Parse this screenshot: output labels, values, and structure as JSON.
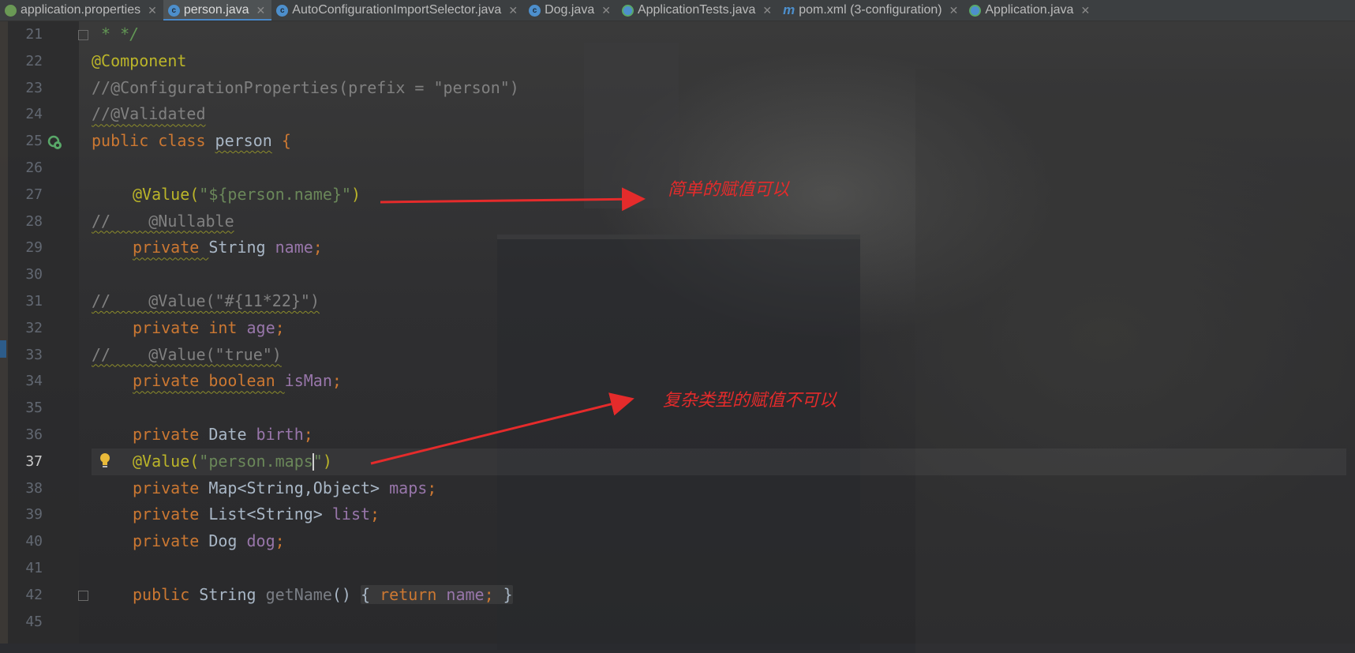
{
  "tabs": [
    {
      "label": "application.properties",
      "icon": "properties-file-icon",
      "kind": "props",
      "active": false
    },
    {
      "label": "person.java",
      "icon": "java-class-icon",
      "kind": "c",
      "active": true
    },
    {
      "label": "AutoConfigurationImportSelector.java",
      "icon": "java-class-icon",
      "kind": "c",
      "active": false
    },
    {
      "label": "Dog.java",
      "icon": "java-class-icon",
      "kind": "c",
      "active": false
    },
    {
      "label": "ApplicationTests.java",
      "icon": "java-test-class-icon",
      "kind": "test",
      "active": false
    },
    {
      "label": "pom.xml (3-configuration)",
      "icon": "maven-icon",
      "kind": "m",
      "active": false
    },
    {
      "label": "Application.java",
      "icon": "spring-boot-app-icon",
      "kind": "test",
      "active": false
    }
  ],
  "line_numbers": [
    "21",
    "22",
    "23",
    "24",
    "25",
    "26",
    "27",
    "28",
    "29",
    "30",
    "31",
    "32",
    "33",
    "34",
    "35",
    "36",
    "37",
    "38",
    "39",
    "40",
    "41",
    "42",
    "45"
  ],
  "current_line": "37",
  "code": {
    "l21": " * */",
    "l22": "@Component",
    "l23": "//@ConfigurationProperties(prefix = \"person\")",
    "l24": "//@Validated",
    "l25_kw": "public class ",
    "l25_name": "person",
    "l25_brace": " {",
    "l27_ann": "@Value(",
    "l27_str": "\"${person.name}\"",
    "l27_end": ")",
    "l28": "//    @Nullable",
    "l29_kw": "private ",
    "l29_type": "String ",
    "l29_field": "name",
    "l29_end": ";",
    "l31": "//    @Value(\"#{11*22}\")",
    "l32_kw": "private int ",
    "l32_field": "age",
    "l32_end": ";",
    "l33": "//    @Value(\"true\")",
    "l34_kw": "private boolean ",
    "l34_field": "isMan",
    "l34_end": ";",
    "l36_kw": "private ",
    "l36_type": "Date ",
    "l36_field": "birth",
    "l36_end": ";",
    "l37_ann": "@Value(",
    "l37_str_a": "\"person.maps",
    "l37_str_b": "\"",
    "l37_end": ")",
    "l38_kw": "private ",
    "l38_type": "Map<String,Object> ",
    "l38_field": "maps",
    "l38_end": ";",
    "l39_kw": "private ",
    "l39_type": "List<String> ",
    "l39_field": "list",
    "l39_end": ";",
    "l40_kw": "private ",
    "l40_type": "Dog ",
    "l40_field": "dog",
    "l40_end": ";",
    "l42_kw": "public ",
    "l42_type": "String ",
    "l42_method": "getName",
    "l42_parens": "() ",
    "l42_open": "{ ",
    "l42_ret": "return ",
    "l42_field": "name",
    "l42_semi": "; ",
    "l42_close": "}"
  },
  "annotations": {
    "simple": "简单的赋值可以",
    "complex": "复杂类型的赋值不可以",
    "color": "#e52b2b"
  }
}
